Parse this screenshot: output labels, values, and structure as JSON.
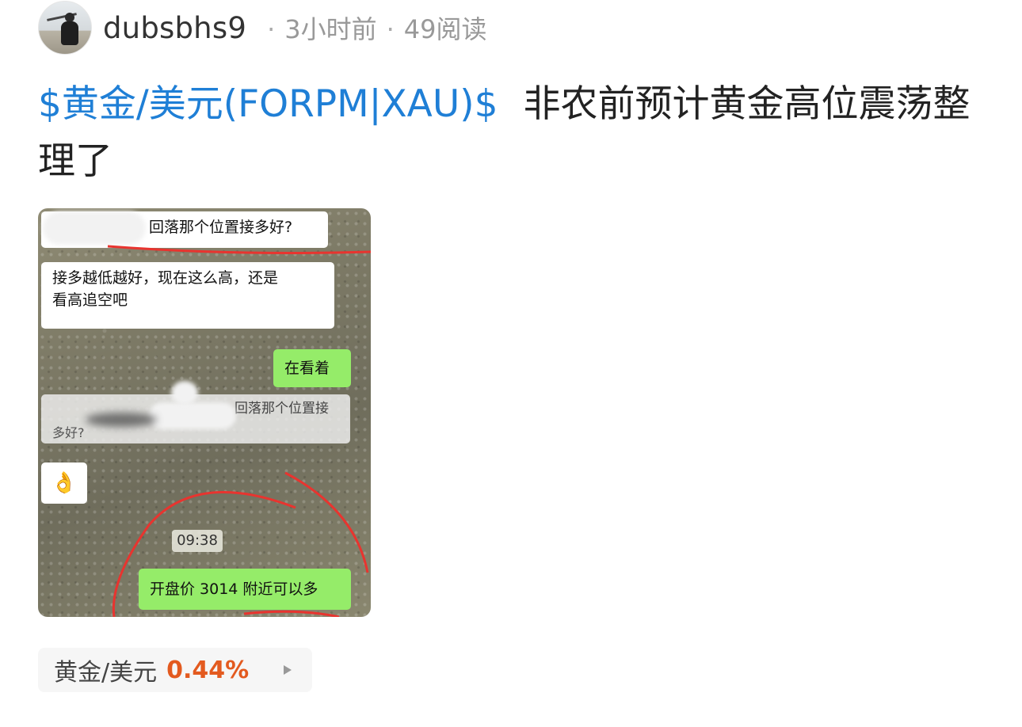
{
  "author": {
    "username": "dubsbhs9",
    "time_ago": "3小时前",
    "reads": "49阅读"
  },
  "post": {
    "stock_tag": "$黄金/美元(FORPM|XAU)$",
    "text": "非农前预计黄金高位震荡整理了"
  },
  "image": {
    "bubble1": "回落那个位置接多好?",
    "bubble2_line1": "接多越低越好，现在这么高，还是",
    "bubble2_line2": "看高追空吧",
    "bubble3": "在看着",
    "bubble4_line1": "回落那个位置接",
    "bubble4_line2": "多好?",
    "ok_emoji": "👌",
    "time": "09:38",
    "bubble5": "开盘价 3014 附近可以多"
  },
  "quote": {
    "name": "黄金/美元",
    "change": "0.44%",
    "change_color": "#e35a1f"
  },
  "colors": {
    "link": "#1f7fd6",
    "wechat_green": "#95ec69",
    "annotation_red": "#e8342f"
  }
}
